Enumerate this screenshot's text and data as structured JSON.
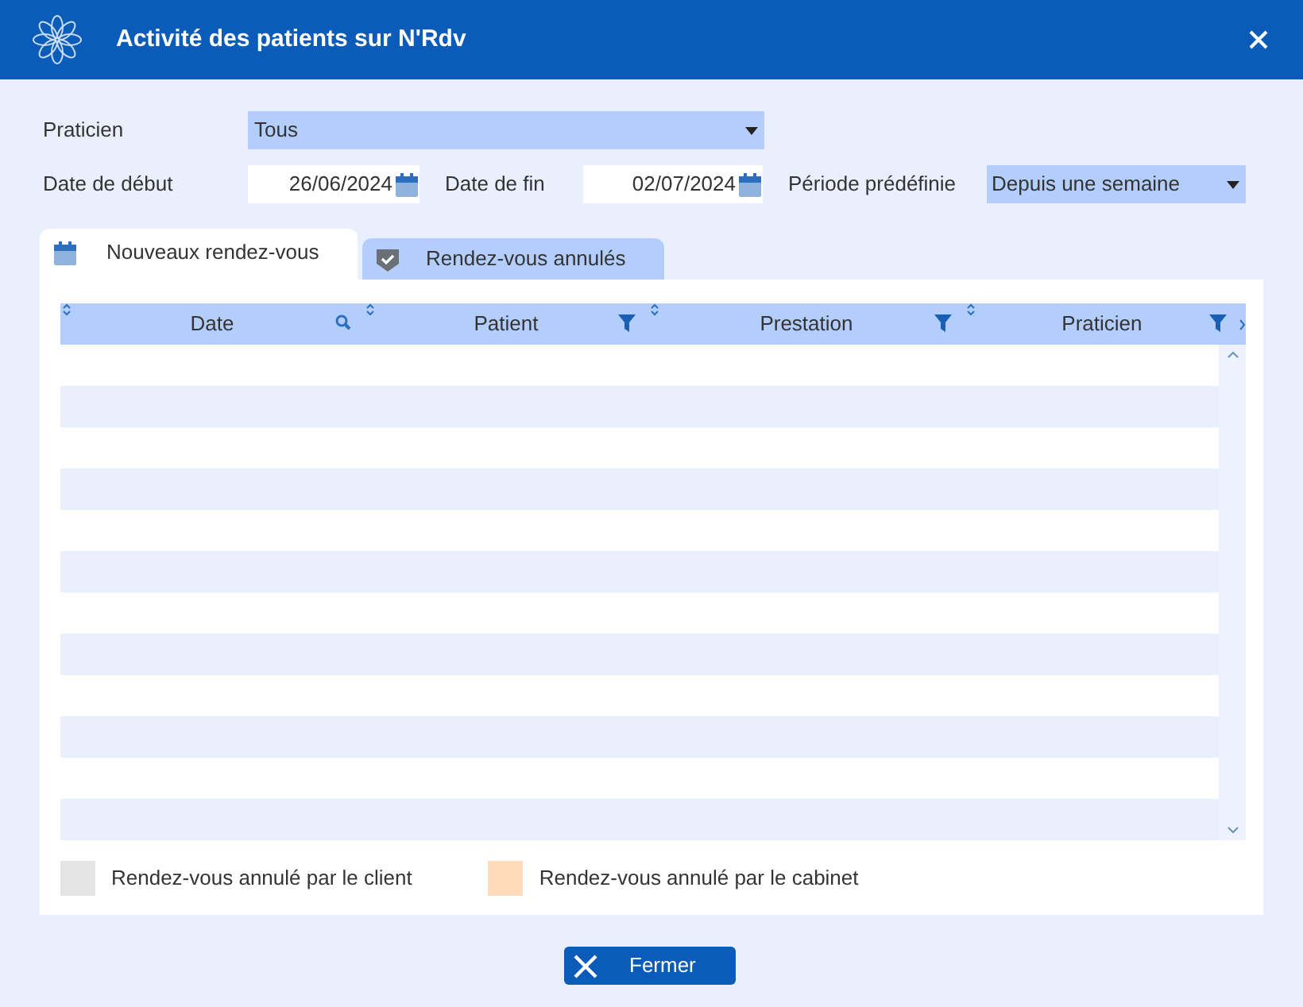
{
  "window": {
    "title": "Activité des patients sur N'Rdv"
  },
  "filters": {
    "practitioner_label": "Praticien",
    "practitioner_value": "Tous",
    "start_label": "Date de début",
    "start_value": "26/06/2024",
    "end_label": "Date de fin",
    "end_value": "02/07/2024",
    "period_label": "Période prédéfinie",
    "period_value": "Depuis une semaine"
  },
  "tabs": [
    {
      "label": "Nouveaux rendez-vous",
      "selected": true,
      "kind": "calendar"
    },
    {
      "label": "Rendez-vous annulés",
      "selected": false,
      "kind": "shield"
    }
  ],
  "table": {
    "columns": [
      {
        "label": "Date",
        "kind": "search"
      },
      {
        "label": "Patient",
        "kind": "filter"
      },
      {
        "label": "Prestation",
        "kind": "filter"
      },
      {
        "label": "Praticien",
        "kind": "filter"
      }
    ]
  },
  "legend": [
    {
      "label": "Rendez-vous annulé par le client",
      "color": "#e4e4e4"
    },
    {
      "label": "Rendez-vous annulé par le cabinet",
      "color": "#ffdbbb"
    }
  ],
  "buttons": {
    "close": "Fermer"
  }
}
